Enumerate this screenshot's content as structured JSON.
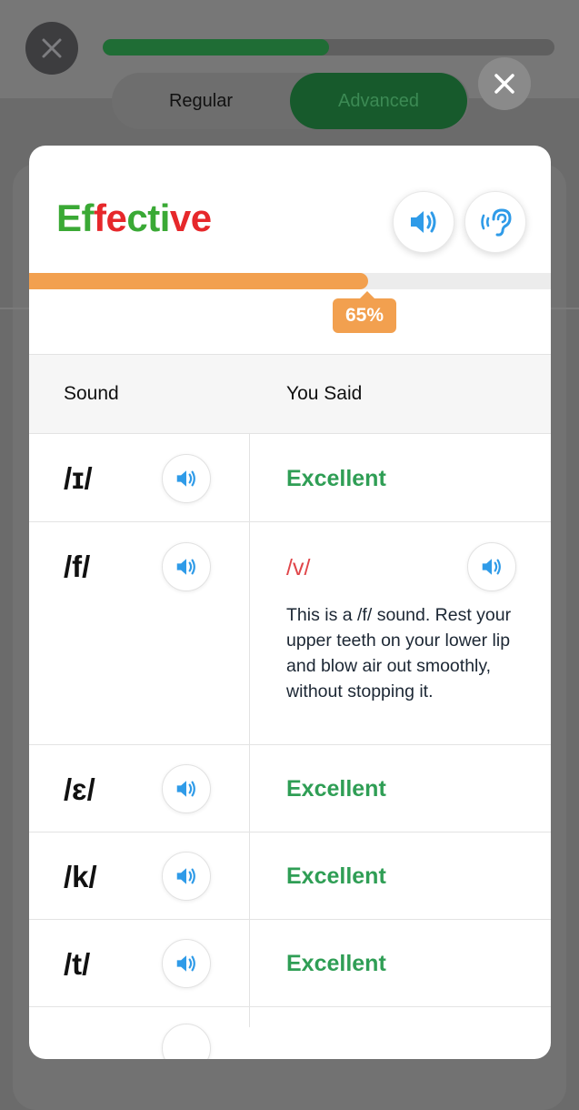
{
  "background": {
    "progress_fraction": 0.5,
    "mode_toggle": {
      "regular_label": "Regular",
      "advanced_label": "Advanced",
      "selected": "Advanced"
    }
  },
  "modal": {
    "title_letters": [
      {
        "ch": "E",
        "color": "green"
      },
      {
        "ch": "f",
        "color": "green"
      },
      {
        "ch": "f",
        "color": "red"
      },
      {
        "ch": "e",
        "color": "red"
      },
      {
        "ch": "c",
        "color": "green"
      },
      {
        "ch": "t",
        "color": "green"
      },
      {
        "ch": "i",
        "color": "green"
      },
      {
        "ch": "v",
        "color": "red"
      },
      {
        "ch": "e",
        "color": "red"
      }
    ],
    "title": "Effective",
    "score_percent": 65,
    "score_label": "65%",
    "table": {
      "col_sound": "Sound",
      "col_you_said": "You Said",
      "rows": [
        {
          "sound": "/ɪ/",
          "result": "Excellent",
          "status": "good"
        },
        {
          "sound": "/f/",
          "result": "/v/",
          "status": "bad",
          "tip": "This is a /f/ sound. Rest your upper teeth on your lower lip and blow air out smoothly, without stopping it."
        },
        {
          "sound": "/ɛ/",
          "result": "Excellent",
          "status": "good"
        },
        {
          "sound": "/k/",
          "result": "Excellent",
          "status": "good"
        },
        {
          "sound": "/t/",
          "result": "Excellent",
          "status": "good"
        }
      ]
    }
  },
  "colors": {
    "green": "#3aa935",
    "red": "#e6282b",
    "excellent": "#2f9e55",
    "orange": "#f2a04f",
    "speaker_blue": "#2f9be8"
  },
  "icons": {
    "close": "close-icon",
    "speaker": "speaker-icon",
    "ear": "ear-listen-icon"
  }
}
